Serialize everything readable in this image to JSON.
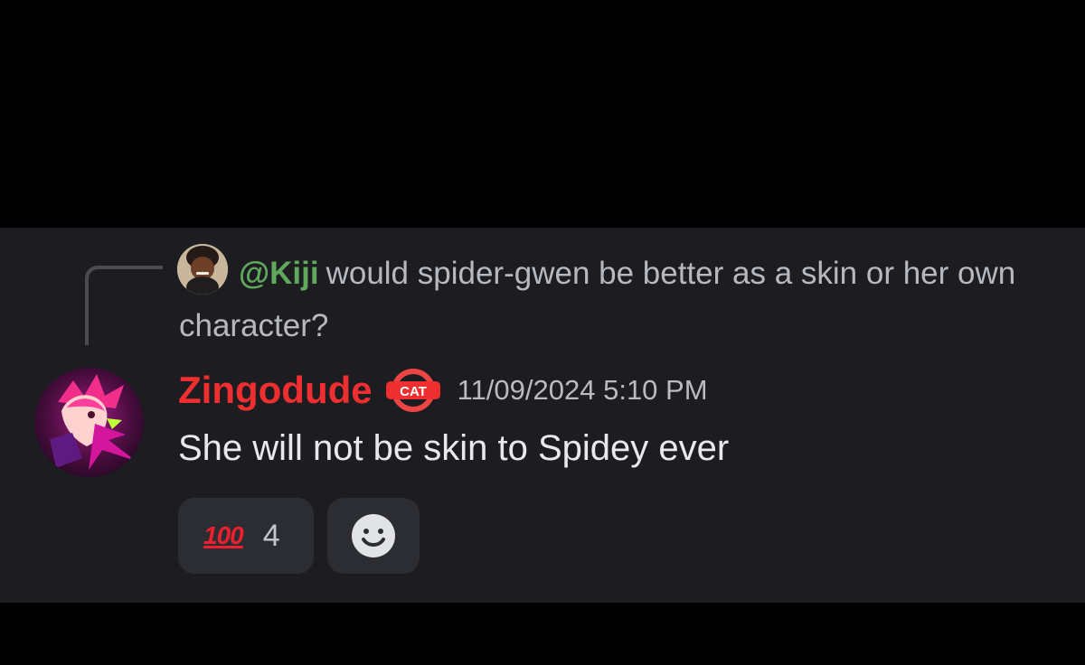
{
  "reply": {
    "mention": "@Kiji",
    "text": "would spider-gwen be better as a skin or her own character?",
    "avatar_icon": "user-avatar"
  },
  "message": {
    "author": "Zingodude",
    "badge": "CAT",
    "timestamp": "11/09/2024 5:10 PM",
    "body": "She will not be skin to Spidey ever",
    "avatar_icon": "anime-character-avatar"
  },
  "reactions": [
    {
      "emoji": "100",
      "count": "4"
    }
  ],
  "controls": {
    "add_reaction_icon": "smiley-icon"
  },
  "colors": {
    "background": "#000000",
    "panel": "#1d1d21",
    "mention": "#5fa85c",
    "author": "#ef2f2f",
    "text": "#e8e9eb"
  }
}
